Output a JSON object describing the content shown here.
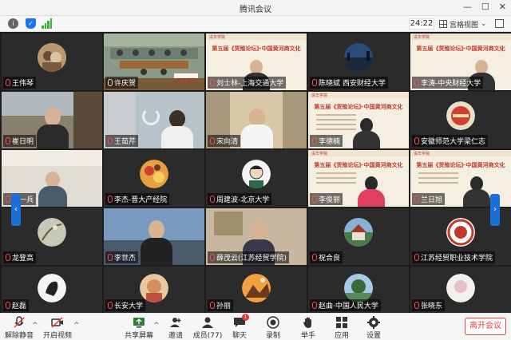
{
  "window": {
    "title": "腾讯会议"
  },
  "topbar": {
    "timer": "24:22",
    "view_label": "宫格视图"
  },
  "slide": {
    "logo": "清华学院",
    "title": "第五届《货殖论坛》·中国黄河商文化"
  },
  "banner": {
    "text": "清华学院"
  },
  "participants": [
    {
      "name": "王伟琴",
      "muted": true
    },
    {
      "name": "许庆贺",
      "muted": false
    },
    {
      "name": "刘士林-上海交通大学",
      "muted": true
    },
    {
      "name": "陈晓斌 西安财经大学",
      "muted": true
    },
    {
      "name": "李涛-中央财经大学",
      "muted": true
    },
    {
      "name": "崔日明",
      "muted": true
    },
    {
      "name": "王茹芹",
      "muted": true
    },
    {
      "name": "宋向清",
      "muted": true
    },
    {
      "name": "李德楠",
      "muted": true
    },
    {
      "name": "安徽师范大学梁仁志",
      "muted": true
    },
    {
      "name": "丁一兵",
      "muted": true
    },
    {
      "name": "李杰-晋大产经院",
      "muted": true
    },
    {
      "name": "周建波-北京大学",
      "muted": true
    },
    {
      "name": "李俊丽",
      "muted": true
    },
    {
      "name": "兰日旭",
      "muted": true
    },
    {
      "name": "龙登高",
      "muted": true
    },
    {
      "name": "李世杰",
      "muted": true
    },
    {
      "name": "薛茂云(江苏经贸学院)",
      "muted": true
    },
    {
      "name": "祝合良",
      "muted": true
    },
    {
      "name": "江苏经贸职业技术学院",
      "muted": true
    },
    {
      "name": "赵磊",
      "muted": true
    },
    {
      "name": "长安大学",
      "muted": true
    },
    {
      "name": "孙丽",
      "muted": true
    },
    {
      "name": "赵曲·中国人民大学",
      "muted": true
    },
    {
      "name": "张晓东",
      "muted": true
    }
  ],
  "toolbar": {
    "mute": "解除静音",
    "video": "开启视频",
    "share": "共享屏幕",
    "invite": "邀请",
    "members": "成员(77)",
    "chat": "聊天",
    "chat_badge": "1",
    "record": "录制",
    "raise_hand": "举手",
    "apps": "应用",
    "settings": "设置",
    "leave": "离开会议"
  }
}
